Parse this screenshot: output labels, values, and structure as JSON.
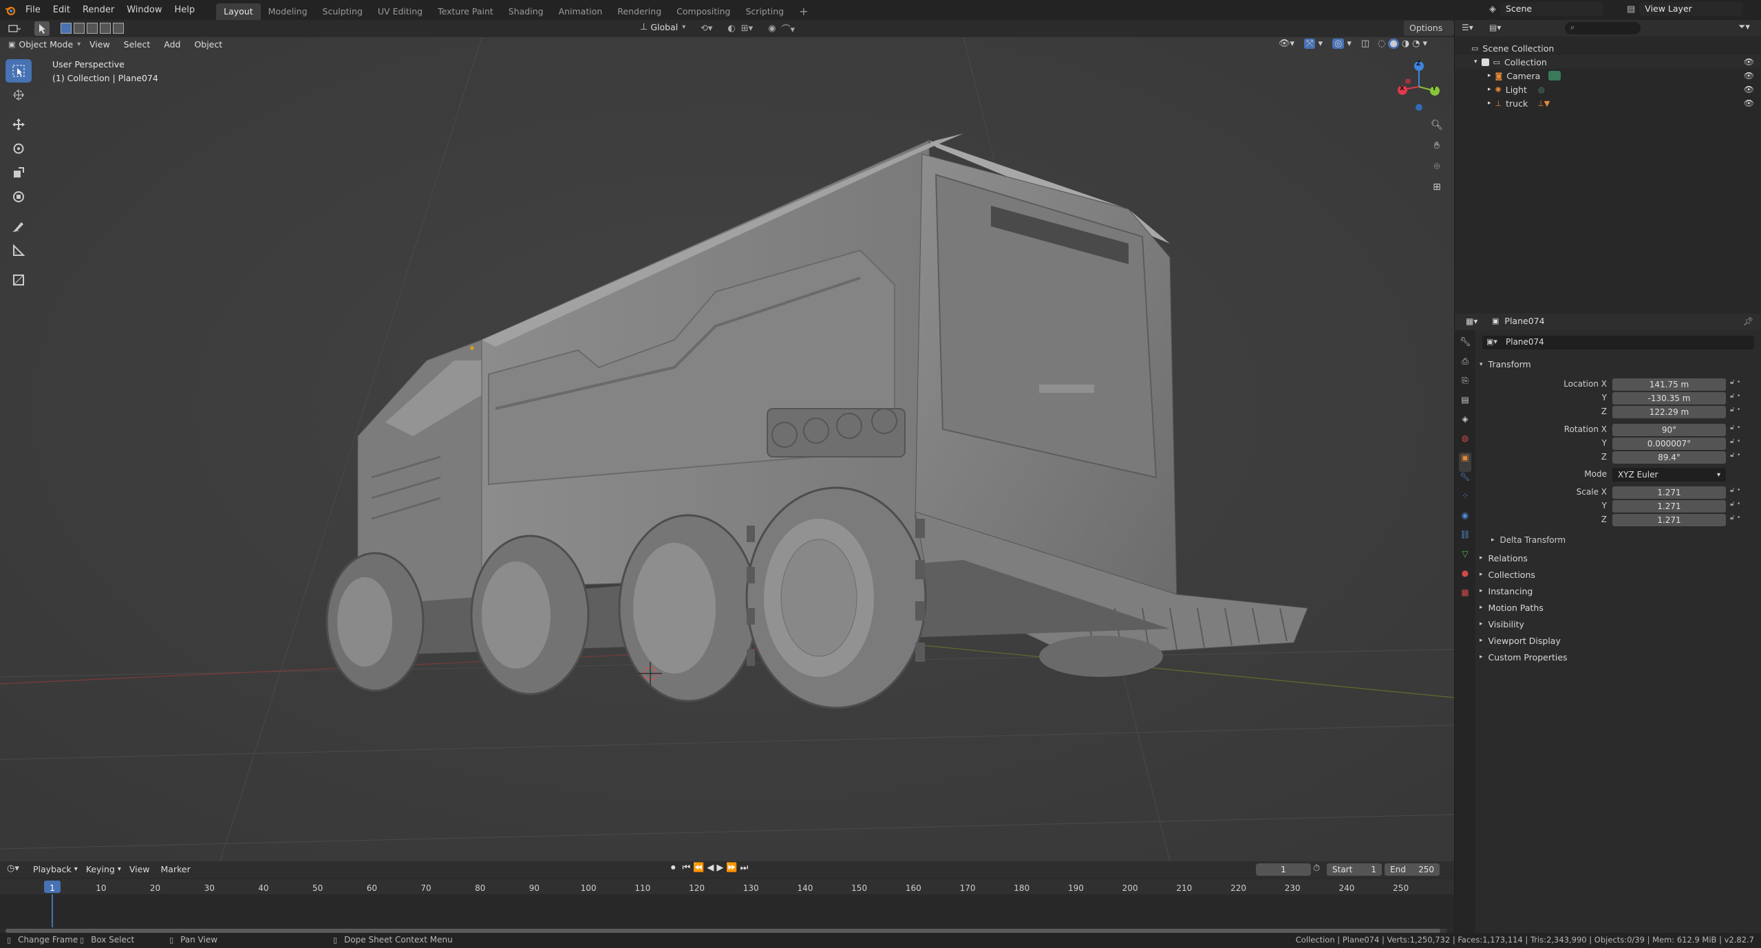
{
  "menubar": {
    "menus": [
      "File",
      "Edit",
      "Render",
      "Window",
      "Help"
    ],
    "workspaces": [
      "Layout",
      "Modeling",
      "Sculpting",
      "UV Editing",
      "Texture Paint",
      "Shading",
      "Animation",
      "Rendering",
      "Compositing",
      "Scripting"
    ],
    "active_workspace": "Layout",
    "scene": "Scene",
    "view_layer": "View Layer"
  },
  "tool_header": {
    "orientation": "Global",
    "options": "Options"
  },
  "viewport_header": {
    "mode": "Object Mode",
    "menus": [
      "View",
      "Select",
      "Add",
      "Object"
    ]
  },
  "viewport": {
    "overlay_line1": "User Perspective",
    "overlay_line2": "(1) Collection | Plane074",
    "gizmo_axes": {
      "x": "X",
      "y": "Y",
      "z": "Z"
    }
  },
  "outliner": {
    "root": "Scene Collection",
    "items": [
      {
        "name": "Collection",
        "icon": "collection-icon"
      },
      {
        "name": "Camera",
        "icon": "camera-icon"
      },
      {
        "name": "Light",
        "icon": "light-icon"
      },
      {
        "name": "truck",
        "icon": "empty-icon"
      }
    ]
  },
  "properties": {
    "object_name": "Plane074",
    "data_name": "Plane074",
    "transform_title": "Transform",
    "location_label": "Location X",
    "location": [
      "141.75 m",
      "-130.35 m",
      "122.29 m"
    ],
    "rotation_label": "Rotation X",
    "rotation": [
      "90°",
      "0.000007°",
      "89.4°"
    ],
    "mode_label": "Mode",
    "mode": "XYZ Euler",
    "scale_label": "Scale X",
    "scale": [
      "1.271",
      "1.271",
      "1.271"
    ],
    "axis_y": "Y",
    "axis_z": "Z",
    "delta": "Delta Transform",
    "panels": [
      "Relations",
      "Collections",
      "Instancing",
      "Motion Paths",
      "Visibility",
      "Viewport Display",
      "Custom Properties"
    ]
  },
  "timeline": {
    "menus": [
      "Playback",
      "Keying",
      "View",
      "Marker"
    ],
    "current_frame": "1",
    "start_label": "Start",
    "start": "1",
    "end_label": "End",
    "end": "250",
    "ticks": [
      "1",
      "10",
      "20",
      "30",
      "40",
      "50",
      "60",
      "70",
      "80",
      "90",
      "100",
      "110",
      "120",
      "130",
      "140",
      "150",
      "160",
      "170",
      "180",
      "190",
      "200",
      "210",
      "220",
      "230",
      "240",
      "250"
    ]
  },
  "statusbar": {
    "left": [
      "Change Frame",
      "Box Select",
      "Pan View",
      "Dope Sheet Context Menu"
    ],
    "right": "Collection | Plane074 | Verts:1,250,732 | Faces:1,173,114 | Tris:2,343,990 | Objects:0/39 | Mem: 612.9 MiB | v2.82.7"
  },
  "colors": {
    "accent": "#4772b3",
    "axis_x": "#e0394b",
    "axis_y": "#8ac43c",
    "axis_z": "#3d85e0"
  }
}
